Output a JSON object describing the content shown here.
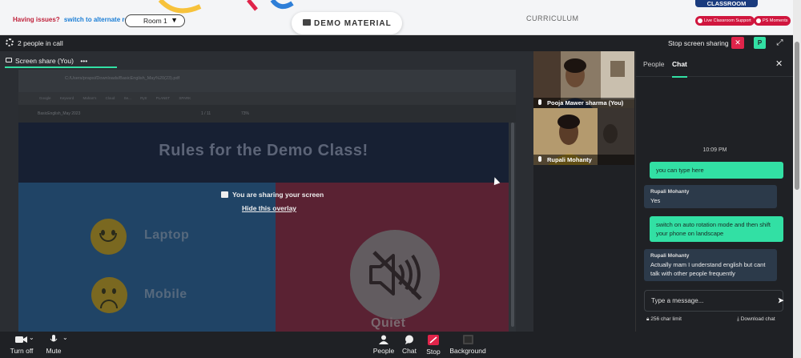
{
  "topbar": {
    "issues_text": "Having issues?",
    "alternate_room_link": "switch to alternate room",
    "room_selected": "Room 1",
    "demo_material_label": "DEMO MATERIAL",
    "curriculum_label": "CURRICULUM",
    "classroom_tag": "CLASSROOM",
    "live_support_label": "Live Classroom Support",
    "ps_moments_label": "PS Moments",
    "accent_red": "#d0163e"
  },
  "callbar": {
    "people_count": "2 people in call",
    "stop_sharing_label": "Stop screen sharing",
    "participant_badge": "P"
  },
  "stage": {
    "share_tab_label": "Screen share (You)",
    "share_tab_menu": "•••",
    "overlay_message": "You are sharing your screen",
    "hide_overlay_link": "Hide this overlay"
  },
  "shared_screen": {
    "url": "C:/Users/prapsi/Downloads/BasicEnglish_May%20(23).pdf",
    "bookmarks": "Google Keyword  Mahan's Cloud Se...  Rytr  PLANET SPARK",
    "pdf_name": "BasicEnglish_May 2023",
    "pdf_page": "1 / 11",
    "pdf_zoom": "73%",
    "slide_title": "Rules for the Demo Class!",
    "laptop_label": "Laptop",
    "mobile_label": "Mobile",
    "quiet_label": "Quiet"
  },
  "videos": [
    {
      "name": "Pooja Mawer sharma (You)"
    },
    {
      "name": "Rupali Mohanty"
    }
  ],
  "chat": {
    "tab_people": "People",
    "tab_chat": "Chat",
    "time": "10:09 PM",
    "messages": [
      {
        "direction": "out",
        "text": "you can type here"
      },
      {
        "direction": "in",
        "sender": "Rupali Mohanty",
        "text": "Yes"
      },
      {
        "direction": "out",
        "text": "switch on auto rotation mode and then shift your phone on landscape"
      },
      {
        "direction": "in",
        "sender": "Rupali Mohanty",
        "text": "Actually mam I understand english but cant talk with other people frequently"
      }
    ],
    "input_placeholder": "Type a message...",
    "char_limit": "256 char limit",
    "download_label": "Download chat",
    "accent_green": "#32e0a4"
  },
  "controls": {
    "turn_off": "Turn off",
    "mute": "Mute",
    "people": "People",
    "chat": "Chat",
    "stop": "Stop",
    "background": "Background"
  }
}
